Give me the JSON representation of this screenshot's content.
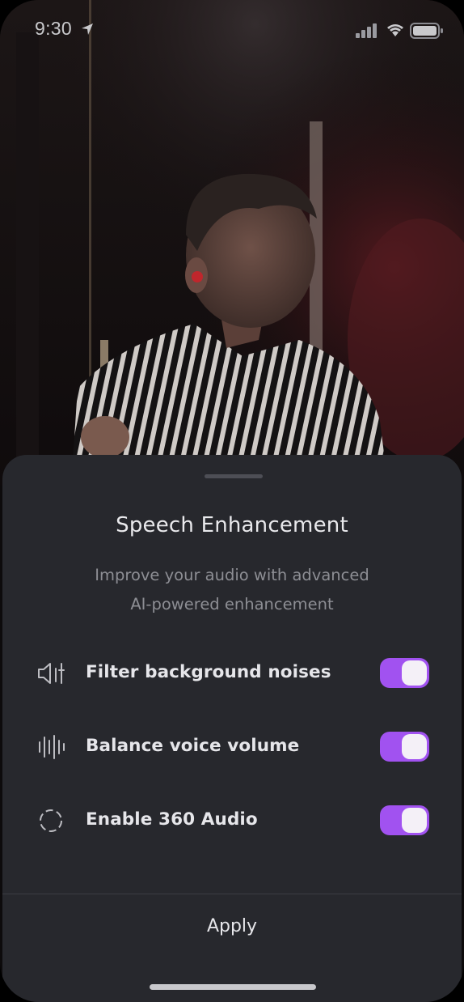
{
  "status_bar": {
    "time": "9:30",
    "location_icon": "location-arrow-icon",
    "signal_icon": "cellular-signal-icon",
    "wifi_icon": "wifi-icon",
    "battery_icon": "battery-icon"
  },
  "sheet": {
    "title": "Speech Enhancement",
    "subtitle_line1": "Improve your audio with advanced",
    "subtitle_line2": "AI-powered enhancement",
    "options": [
      {
        "label": "Filter background noises",
        "icon": "speaker-filter-icon",
        "enabled": true
      },
      {
        "label": "Balance voice volume",
        "icon": "waveform-icon",
        "enabled": true
      },
      {
        "label": "Enable 360 Audio",
        "icon": "dashed-circle-icon",
        "enabled": true
      }
    ],
    "apply_label": "Apply"
  },
  "colors": {
    "accent": "#a152f0",
    "sheet_bg": "#27282d",
    "text_primary": "#e6e6ea",
    "text_secondary": "#8d8e94"
  }
}
